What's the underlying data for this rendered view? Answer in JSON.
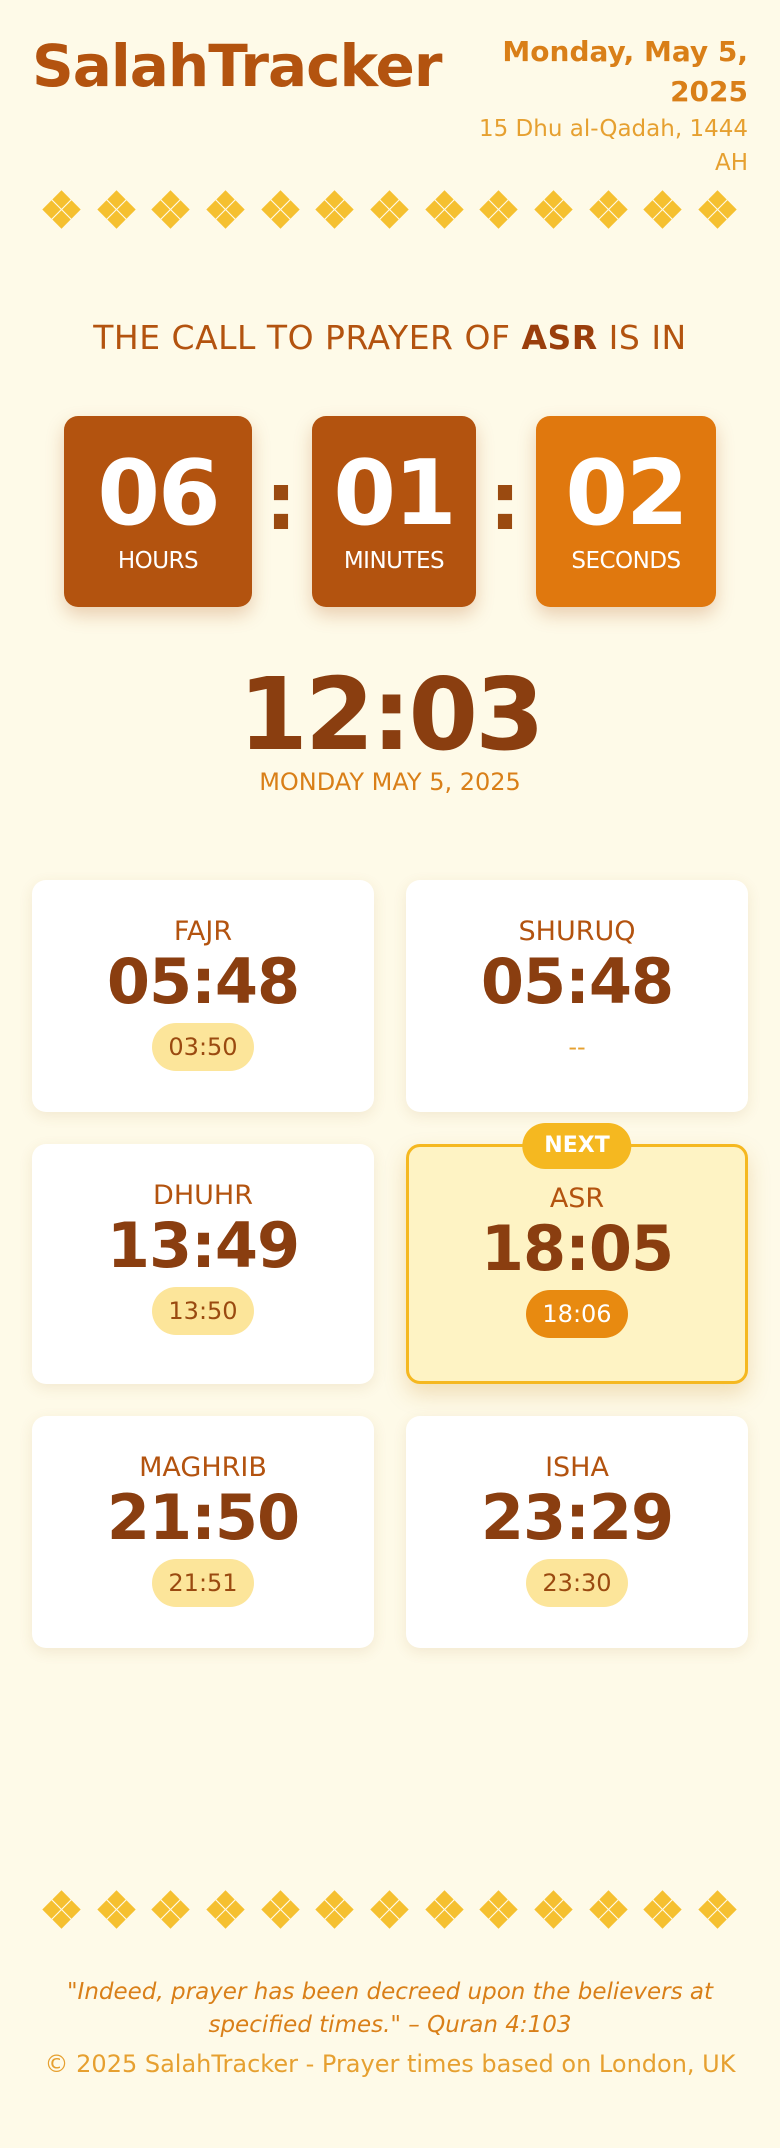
{
  "header": {
    "app_name": "SalahTracker",
    "gregorian_date_line1": "Monday, May 5,",
    "gregorian_date_line2": "2025",
    "hijri_date_line1": "15 Dhu al-Qadah, 1444",
    "hijri_date_line2": "AH"
  },
  "countdown": {
    "prefix": "THE CALL TO PRAYER OF",
    "prayer": "ASR",
    "suffix": "IS IN",
    "hours": "06",
    "hours_label": "HOURS",
    "minutes": "01",
    "minutes_label": "MINUTES",
    "seconds": "02",
    "seconds_label": "SECONDS",
    "separator": ":"
  },
  "clock": {
    "time": "12:03",
    "date": "MONDAY MAY 5, 2025"
  },
  "prayers": [
    {
      "name": "FAJR",
      "time": "05:48",
      "iqama": "03:50"
    },
    {
      "name": "SHURUQ",
      "time": "05:48",
      "iqama": "--"
    },
    {
      "name": "DHUHR",
      "time": "13:49",
      "iqama": "13:50"
    },
    {
      "name": "ASR",
      "time": "18:05",
      "iqama": "18:06",
      "badge": "NEXT"
    },
    {
      "name": "MAGHRIB",
      "time": "21:50",
      "iqama": "21:51"
    },
    {
      "name": "ISHA",
      "time": "23:29",
      "iqama": "23:30"
    }
  ],
  "footer": {
    "quote_line1": "\"Indeed, prayer has been decreed upon the believers at",
    "quote_line2": "specified times.\" – Quran 4:103",
    "copyright": "© 2025 SalahTracker - Prayer times based on London, UK"
  },
  "colors": {
    "background": "#fefae8",
    "brand": "#b3530f",
    "accent": "#d97f18",
    "gold": "#f5b820",
    "box_dark": "#b3530f",
    "box_light": "#e0780e"
  },
  "ornament_icon": "diamond-cluster-icon"
}
